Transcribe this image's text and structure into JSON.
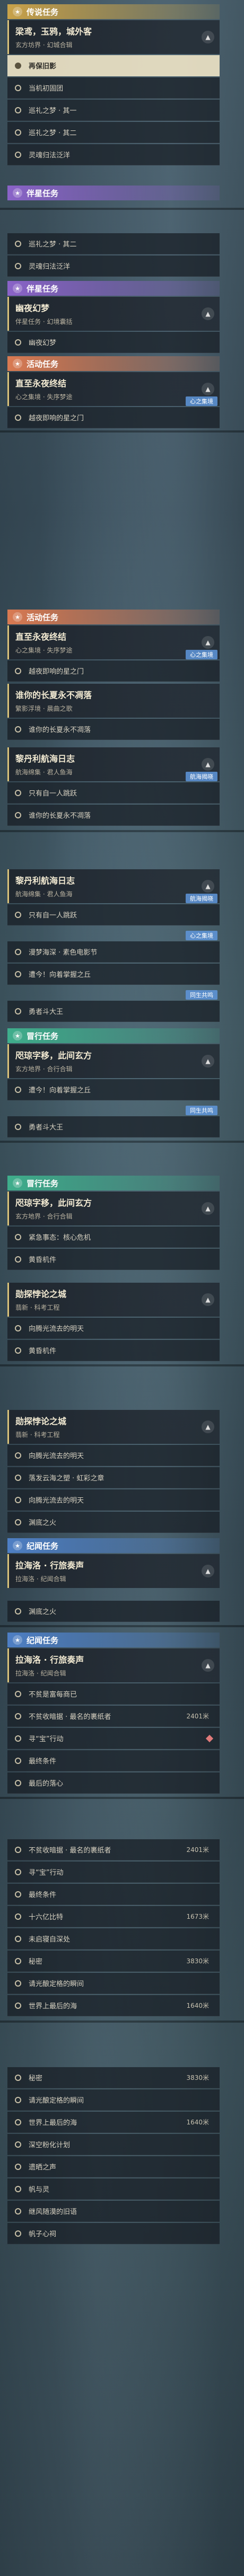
{
  "legend": {
    "category": "传说任务",
    "quest": {
      "title": "梁鸢，玉鸦，城外客",
      "subtitle": "玄方坊界 · 幻城合辑"
    },
    "steps": [
      "再保旧影",
      "当机初固团",
      "巡礼之梦 · 其一",
      "巡礼之梦 · 其二",
      "灵魂归法泛洋"
    ]
  },
  "companion": {
    "category": "伴星任务",
    "steps_pre": [
      "巡礼之梦 · 其二",
      "灵魂归法泛洋"
    ],
    "category2": "伴星任务",
    "quest": {
      "title": "幽夜幻梦",
      "subtitle": "伴星任务 · 幻境囊括"
    },
    "steps": [
      "幽夜幻梦"
    ]
  },
  "event1": {
    "category": "活动任务",
    "quest": {
      "title": "直至永夜终结",
      "subtitle": "心之集境 · 失序梦途"
    },
    "steps": [
      "越夜即响的星之门"
    ],
    "badge": "心之集境"
  },
  "event2": {
    "category": "活动任务",
    "quest1": {
      "title": "直至永夜终结",
      "subtitle": "心之集境 · 失序梦途"
    },
    "steps1": [
      "越夜即响的星之门"
    ],
    "badge": "心之集境",
    "quest2": {
      "title": "谁你的长夏永不凋落",
      "subtitle": "繁影浮境 · 晨曲之歌"
    },
    "steps2": [
      "谁你的长夏永不凋落"
    ]
  },
  "voyage": {
    "quest": {
      "title": "黎丹利航海日志",
      "subtitle": "航海绵集 · 君人鱼海"
    },
    "badge": "航海揭晓",
    "steps": [
      "只有自一人跳跃",
      "谁你的长夏永不凋落"
    ],
    "quest2": {
      "title": "黎丹利航海日志",
      "subtitle": "航海绵集 · 君人鱼海"
    },
    "badge2": "航海揭晓",
    "steps2": [
      "只有自一人跳跃",
      "漫梦海深 · 素色电影节",
      "遭今！向着掌握之丘",
      "勇者斗大王"
    ],
    "badge3": "心之集境",
    "badge4": "同生共鸣"
  },
  "adventure1": {
    "category": "冒行任务",
    "quest": {
      "title": "咫琼字移，此间玄方",
      "subtitle": "玄方地界 · 合行合辑"
    },
    "steps": [
      "遭今！向着掌握之丘",
      "勇者斗大王"
    ],
    "badge": "同生共鸣"
  },
  "adventure2": {
    "category": "冒行任务",
    "quest": {
      "title": "咫琼字移，此间玄方",
      "subtitle": "玄方地界 · 合行合辑"
    },
    "steps": [
      "紧急事态：核心危机",
      "黄昏机件"
    ]
  },
  "adventure3": {
    "quest": {
      "title": "勋探悖论之城",
      "subtitle": "翡新 · 科考工程"
    },
    "steps": [
      "向腾光流去的明天",
      "黄昏机件"
    ]
  },
  "adventure4": {
    "quest": {
      "title": "勋探悖论之城",
      "subtitle": "翡新 · 科考工程"
    },
    "steps": [
      "向腾光流去的明天",
      "落发云海之塑 · 虹彩之章",
      "向腾光流去的明天",
      "渊底之火"
    ]
  },
  "chronicle1": {
    "category": "纪闻任务",
    "quest": {
      "title": "拉海洛 · 行旅奏声",
      "subtitle": "拉海洛 · 纪闻合辑"
    },
    "steps": [
      "渊底之火"
    ]
  },
  "chronicle2": {
    "category": "纪闻任务",
    "quest": {
      "title": "拉海洛 · 行旅奏声",
      "subtitle": "拉海洛 · 纪闻合辑"
    },
    "steps": [
      {
        "label": "不贫是富每商已",
        "dist": ""
      },
      {
        "label": "不贫收暗据 · 最名的裹纸者",
        "dist": "2401米"
      },
      {
        "label": "寻“宝”行动",
        "dist": ""
      },
      {
        "label": "最终条件",
        "dist": ""
      },
      {
        "label": "最后的落心",
        "dist": ""
      }
    ]
  },
  "chronicle3": {
    "steps": [
      {
        "label": "不贫收暗据 · 最名的裹纸者",
        "dist": "2401米"
      },
      {
        "label": "寻“宝”行动",
        "dist": ""
      },
      {
        "label": "最终条件",
        "dist": ""
      },
      {
        "label": "十六亿比特",
        "dist": "1673米"
      },
      {
        "label": "未启寝自深处",
        "dist": ""
      },
      {
        "label": "秘密",
        "dist": "3830米"
      },
      {
        "label": "请光酿定格的瞬间",
        "dist": ""
      },
      {
        "label": "世界上最后的海",
        "dist": "1640米"
      }
    ]
  },
  "chronicle4": {
    "steps": [
      {
        "label": "秘密",
        "dist": "3830米"
      },
      {
        "label": "请光酿定格的瞬间",
        "dist": ""
      },
      {
        "label": "世界上最后的海",
        "dist": "1640米"
      },
      {
        "label": "深空粉化计划",
        "dist": ""
      },
      {
        "label": "遗晒之声",
        "dist": ""
      },
      {
        "label": "帆与灵",
        "dist": ""
      },
      {
        "label": "继风随漠的旧语",
        "dist": ""
      },
      {
        "label": "帆子心祠",
        "dist": ""
      }
    ]
  },
  "colors": {
    "legend": "#c8a24a",
    "companion": "#8a63c8",
    "event": "#d97a52",
    "adventure": "#3fae8c",
    "chronicle": "#4e7fc4"
  },
  "icons": {
    "category": "star-icon",
    "toggle": "chevron-up-icon",
    "step": "circle-icon",
    "marker": "diamond-icon"
  }
}
